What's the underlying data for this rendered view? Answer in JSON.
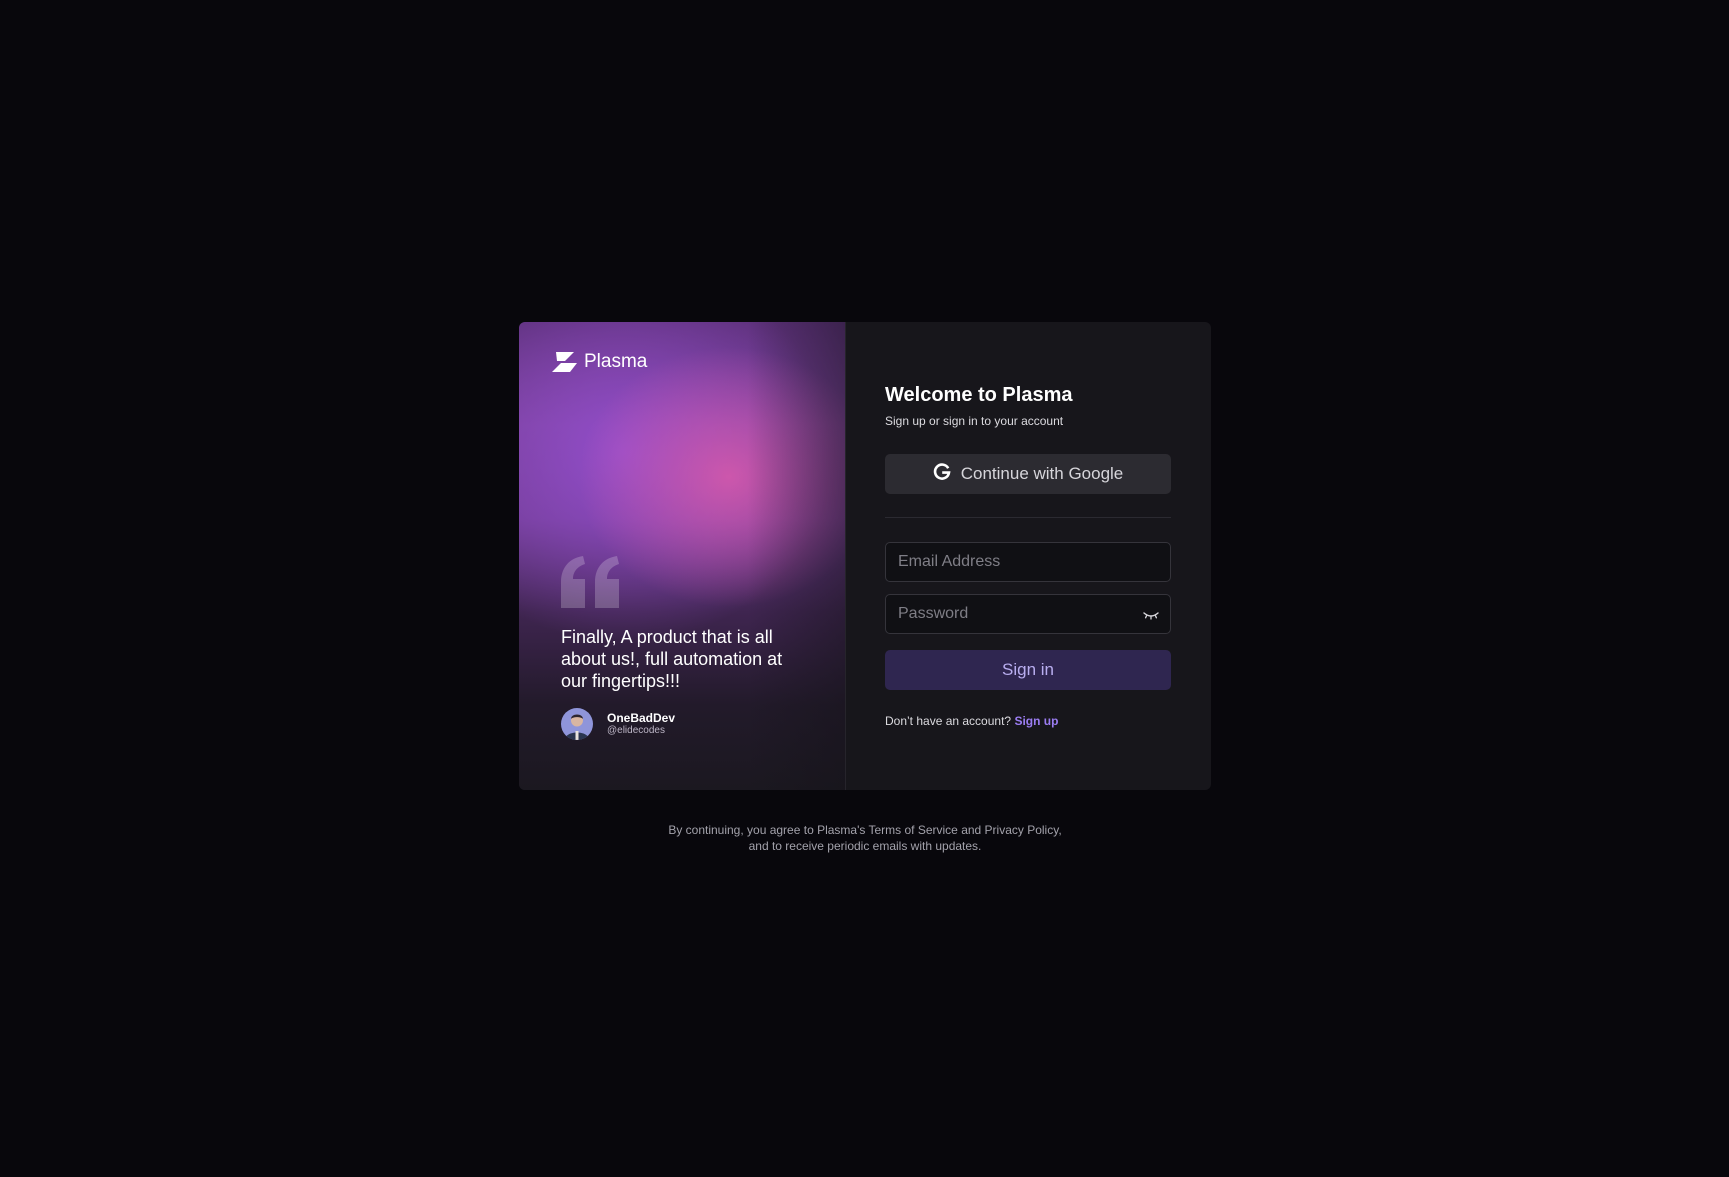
{
  "brand": {
    "name": "Plasma"
  },
  "testimonial": {
    "quote": "Finally, A product that is all about us!, full automation at our fingertips!!!",
    "author_name": "OneBadDev",
    "author_handle": "@elidecodes"
  },
  "form": {
    "title": "Welcome to Plasma",
    "subtitle": "Sign up or sign in to your account",
    "google_label": "Continue with Google",
    "email_placeholder": "Email Address",
    "password_placeholder": "Password",
    "signin_label": "Sign in",
    "no_account_text": "Don’t have an account?",
    "signup_label": "Sign up"
  },
  "legal": {
    "text": "By continuing, you agree to Plasma's Terms of Service and Privacy Policy, and to receive periodic emails with updates."
  },
  "icons": {
    "logo": "lightning-bolt-icon",
    "quote": "quotation-mark-icon",
    "google": "google-g-icon",
    "password_toggle": "eye-closed-icon"
  },
  "colors": {
    "page_background": "#08070c",
    "card_background": "#17161b",
    "primary_button": "#2f2650",
    "accent_link": "#9b7df2"
  }
}
